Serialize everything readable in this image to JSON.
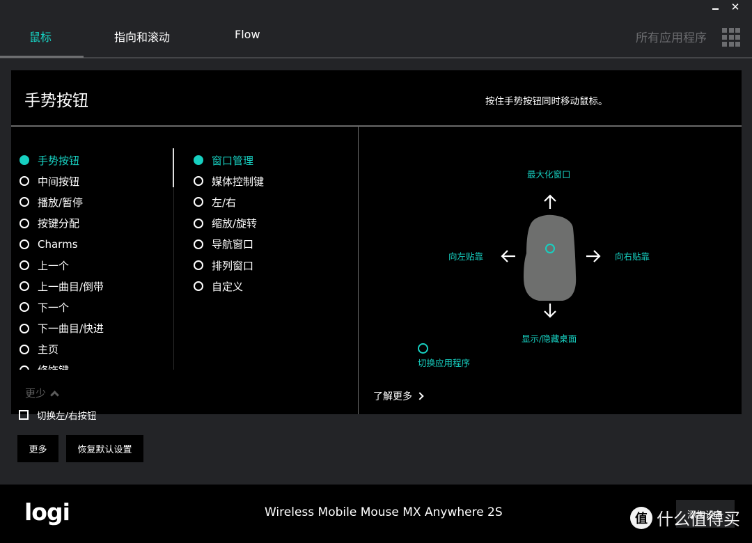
{
  "window": {
    "minimize_label": "–",
    "close_label": "✕"
  },
  "tabs": [
    {
      "label": "鼠标",
      "active": true
    },
    {
      "label": "指向和滚动",
      "active": false
    },
    {
      "label": "Flow",
      "active": false
    }
  ],
  "all_apps": {
    "label": "所有应用程序",
    "icon": "grid-icon"
  },
  "panel": {
    "title": "手势按钮",
    "hint": "按住手势按钮同时移动鼠标。",
    "button_list": [
      {
        "label": "手势按钮",
        "selected": true
      },
      {
        "label": "中间按钮",
        "selected": false
      },
      {
        "label": "播放/暂停",
        "selected": false
      },
      {
        "label": "按键分配",
        "selected": false
      },
      {
        "label": "Charms",
        "selected": false
      },
      {
        "label": "上一个",
        "selected": false
      },
      {
        "label": "上一曲目/倒带",
        "selected": false
      },
      {
        "label": "下一个",
        "selected": false
      },
      {
        "label": "下一曲目/快进",
        "selected": false
      },
      {
        "label": "主页",
        "selected": false
      },
      {
        "label": "修饰键",
        "selected": false
      }
    ],
    "gesture_list": [
      {
        "label": "窗口管理",
        "selected": true
      },
      {
        "label": "媒体控制键",
        "selected": false
      },
      {
        "label": "左/右",
        "selected": false
      },
      {
        "label": "缩放/旋转",
        "selected": false
      },
      {
        "label": "导航窗口",
        "selected": false
      },
      {
        "label": "排列窗口",
        "selected": false
      },
      {
        "label": "自定义",
        "selected": false
      }
    ],
    "less_label": "更少",
    "learn_more_label": "了解更多",
    "gestures": {
      "up": "最大化窗口",
      "left": "向左贴靠",
      "right": "向右贴靠",
      "down": "显示/隐藏桌面",
      "click": "切换应用程序"
    }
  },
  "options": {
    "swap_buttons_label": "切换左/右按钮",
    "swap_buttons_checked": false,
    "more_label": "更多",
    "reset_label": "恢复默认设置"
  },
  "footer": {
    "logo": "logi",
    "device_name": "Wireless Mobile Mouse MX Anywhere 2S",
    "add_device_label": "添加设备",
    "watermark_badge": "值",
    "watermark_text": "什么值得买"
  },
  "colors": {
    "accent": "#17d0c1",
    "background": "#232427",
    "panel": "#000000",
    "muted": "#6c6d70"
  }
}
